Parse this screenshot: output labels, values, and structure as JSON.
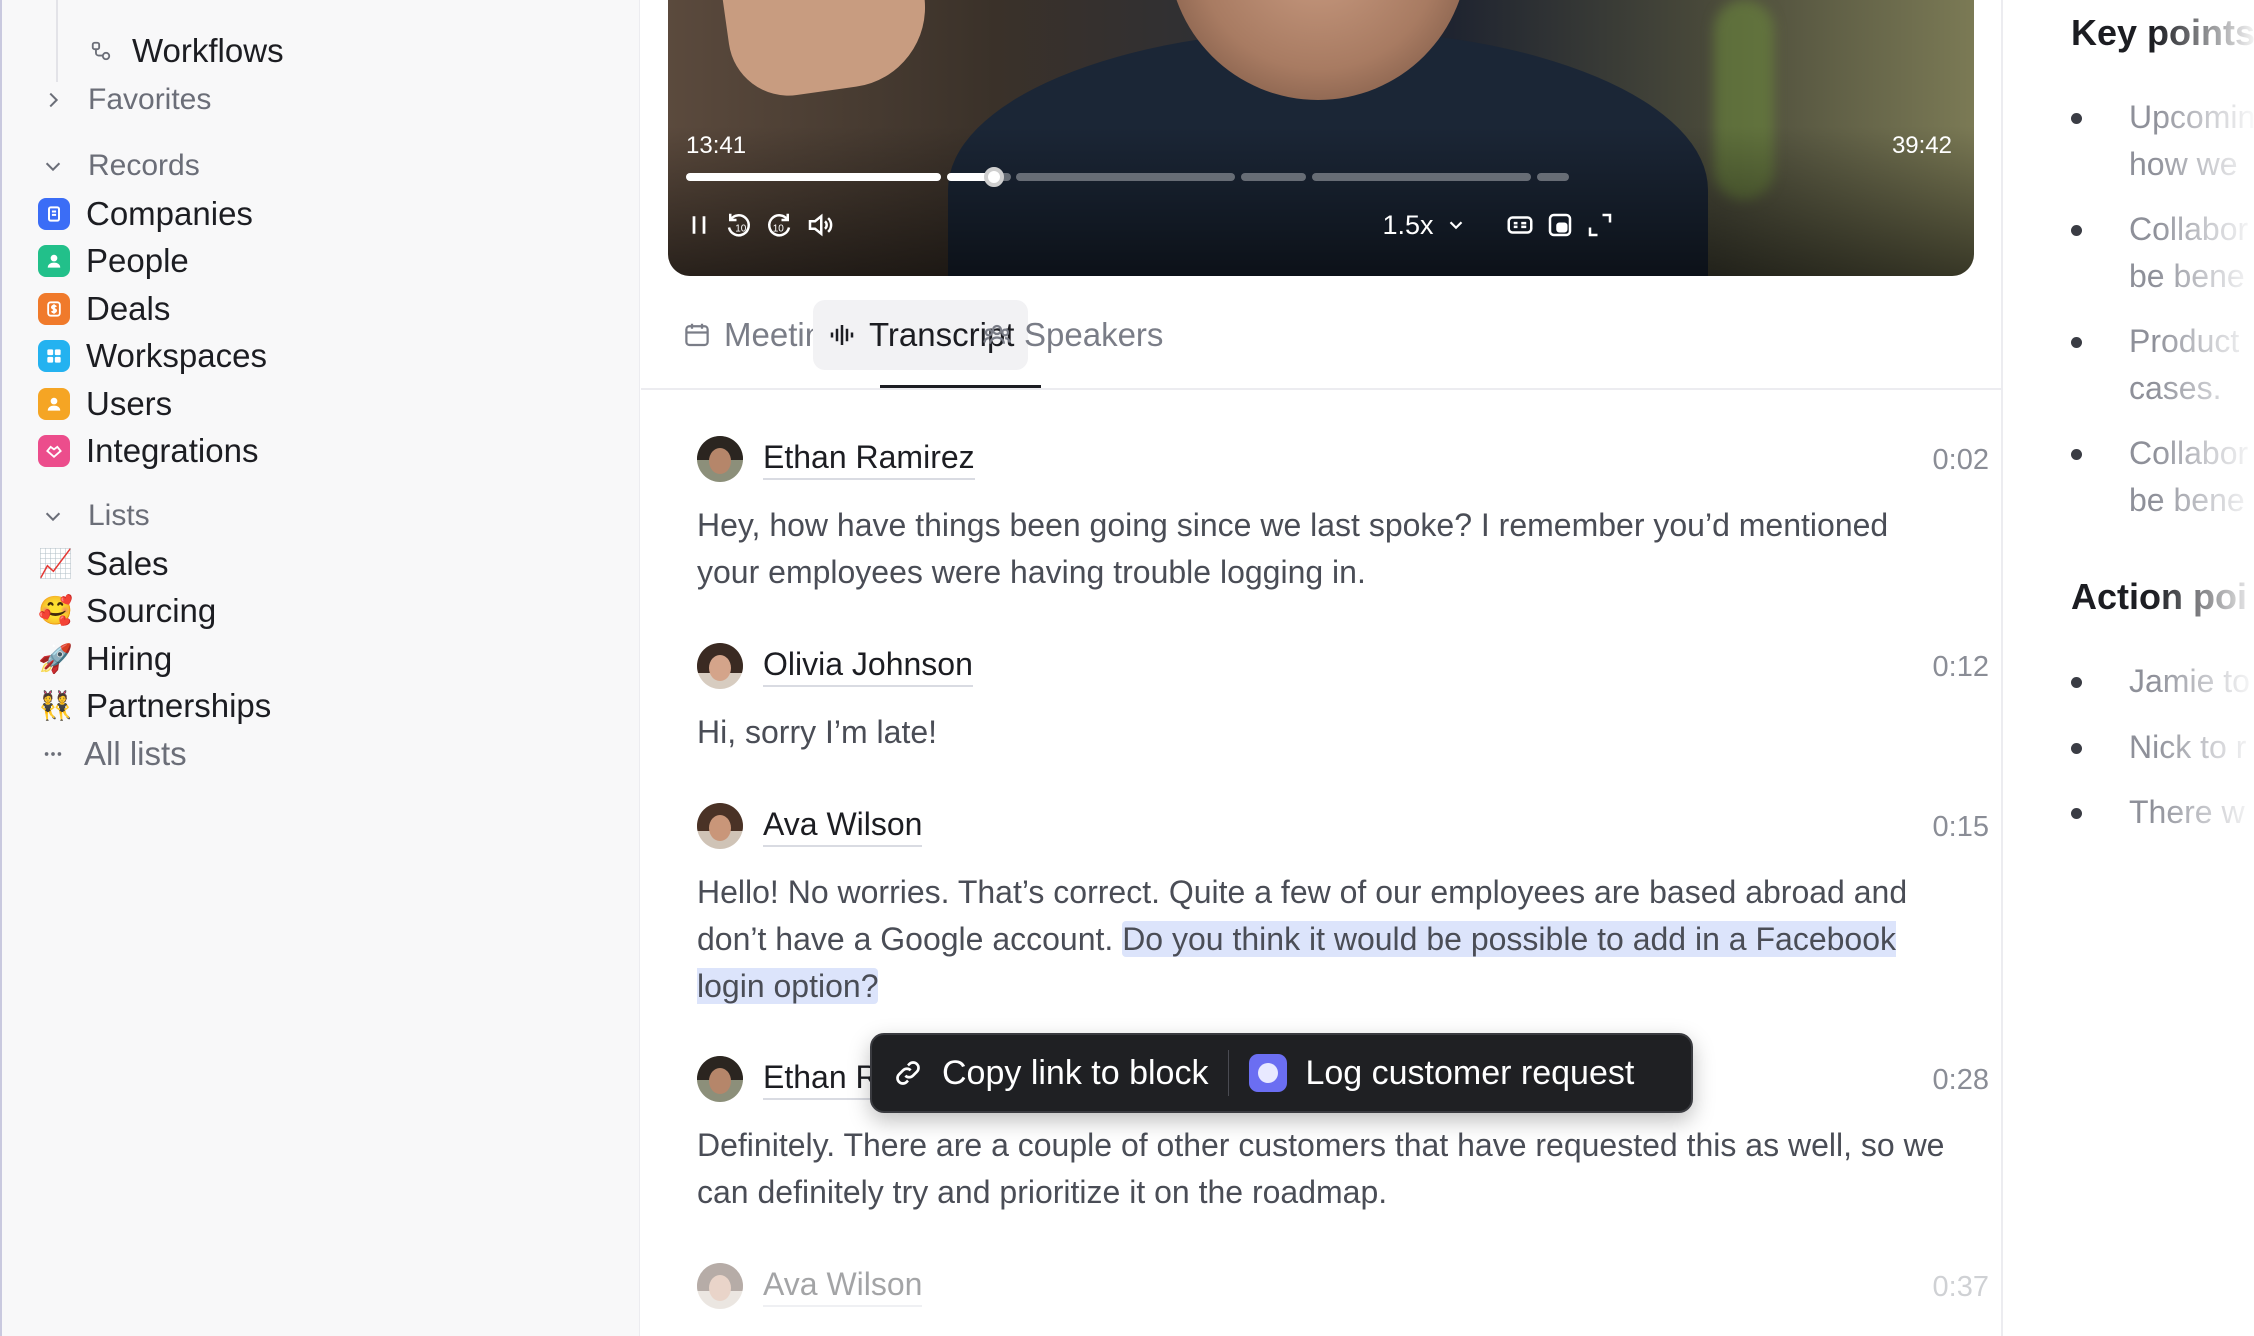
{
  "sidebar": {
    "workflows_label": "Workflows",
    "favorites_label": "Favorites",
    "records_label": "Records",
    "records": [
      {
        "label": "Companies",
        "color": "#3b6df6"
      },
      {
        "label": "People",
        "color": "#22c08a"
      },
      {
        "label": "Deals",
        "color": "#f07a2b"
      },
      {
        "label": "Workspaces",
        "color": "#24b2f0"
      },
      {
        "label": "Users",
        "color": "#f5a524"
      },
      {
        "label": "Integrations",
        "color": "#ec4d8c"
      }
    ],
    "lists_label": "Lists",
    "lists": [
      {
        "label": "Sales",
        "emoji": "📈"
      },
      {
        "label": "Sourcing",
        "emoji": "🥰"
      },
      {
        "label": "Hiring",
        "emoji": "🚀"
      },
      {
        "label": "Partnerships",
        "emoji": "👯"
      }
    ],
    "all_lists_label": "All lists"
  },
  "video": {
    "current_time": "13:41",
    "duration": "39:42",
    "played_fraction": 0.35,
    "speed": "1.5x"
  },
  "tabs": [
    {
      "label": "Meeting",
      "active": false
    },
    {
      "label": "Transcript",
      "active": true
    },
    {
      "label": "Speakers",
      "active": false
    }
  ],
  "transcript": [
    {
      "speaker": "Ethan Ramirez",
      "time": "0:02",
      "text": "Hey, how have things been going since we last spoke? I remember you’d mentioned your employees were having trouble logging in."
    },
    {
      "speaker": "Olivia Johnson",
      "time": "0:12",
      "text": "Hi, sorry I’m late!"
    },
    {
      "speaker": "Ava Wilson",
      "time": "0:15",
      "text_plain": "Hello! No worries. That’s correct. Quite a few of our employees are based abroad and don’t have a Google account.",
      "text_highlight": "Do you think it would be possible to add in a Facebook login option?"
    },
    {
      "speaker": "Ethan Ramirez",
      "speaker_visible": "Ethan R",
      "time": "0:28",
      "text": "Definitely. There are a couple of other customers that have requested this as well, so we can definitely try and prioritize it on the roadmap."
    },
    {
      "speaker": "Ava Wilson",
      "time": "0:37"
    }
  ],
  "selection_toolbar": {
    "copy_link_label": "Copy link to block",
    "log_request_label": "Log customer request"
  },
  "right_panel": {
    "key_points_heading": "Key points",
    "key_points": [
      {
        "line1": "Upcoming",
        "line2": "how we"
      },
      {
        "line1": "Collabor",
        "line2": "be bene"
      },
      {
        "line1": "Product",
        "line2": "cases."
      },
      {
        "line1": "Collabor",
        "line2": "be bene"
      }
    ],
    "action_points_heading": "Action poi",
    "action_points": [
      "Jamie to",
      "Nick to r",
      "There w"
    ]
  }
}
